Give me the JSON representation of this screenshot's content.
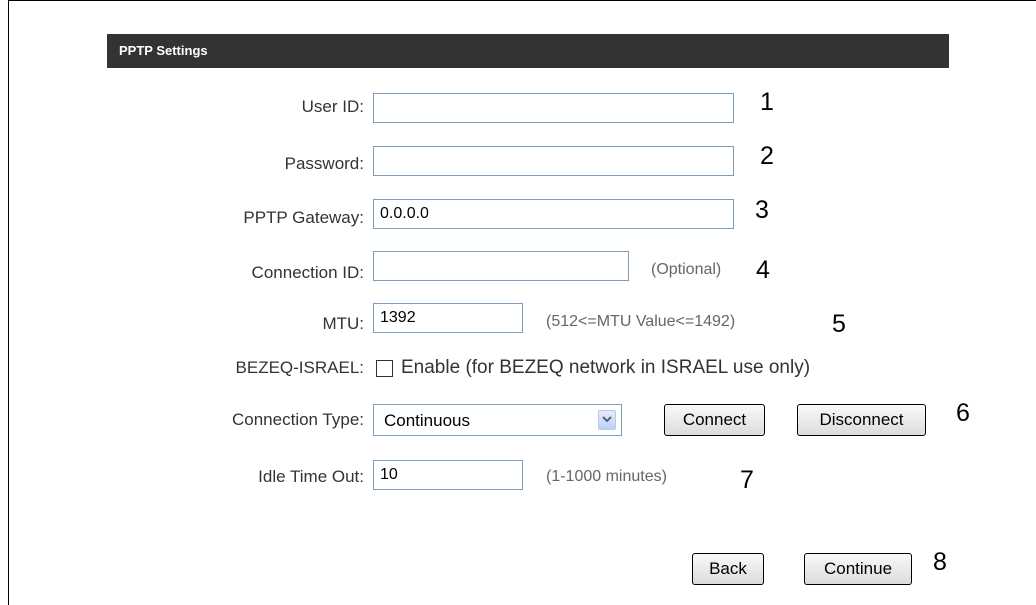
{
  "header": {
    "title": "PPTP Settings"
  },
  "form": {
    "user_id": {
      "label": "User ID:",
      "value": "",
      "marker": "1"
    },
    "password": {
      "label": "Password:",
      "value": "",
      "marker": "2"
    },
    "pptp_gateway": {
      "label": "PPTP Gateway:",
      "value": "0.0.0.0",
      "marker": "3"
    },
    "connection_id": {
      "label": "Connection ID:",
      "value": "",
      "hint": "(Optional)",
      "marker": "4"
    },
    "mtu": {
      "label": "MTU:",
      "value": "1392",
      "hint": "(512<=MTU Value<=1492)",
      "marker": "5"
    },
    "bezeq": {
      "label": "BEZEQ-ISRAEL:",
      "checkbox_label": "Enable (for BEZEQ network in ISRAEL use only)",
      "checked": false
    },
    "connection_type": {
      "label": "Connection Type:",
      "selected": "Continuous",
      "connect_label": "Connect",
      "disconnect_label": "Disconnect",
      "marker": "6"
    },
    "idle_time_out": {
      "label": "Idle Time Out:",
      "value": "10",
      "hint": "(1-1000 minutes)",
      "marker": "7"
    }
  },
  "footer": {
    "back_label": "Back",
    "continue_label": "Continue",
    "marker": "8"
  },
  "colors": {
    "header_bg": "#333333",
    "input_border": "#7f9db9",
    "label_text": "#333333",
    "hint_text": "#666666"
  },
  "icons": {
    "select_arrow": "chevron-down-icon"
  }
}
